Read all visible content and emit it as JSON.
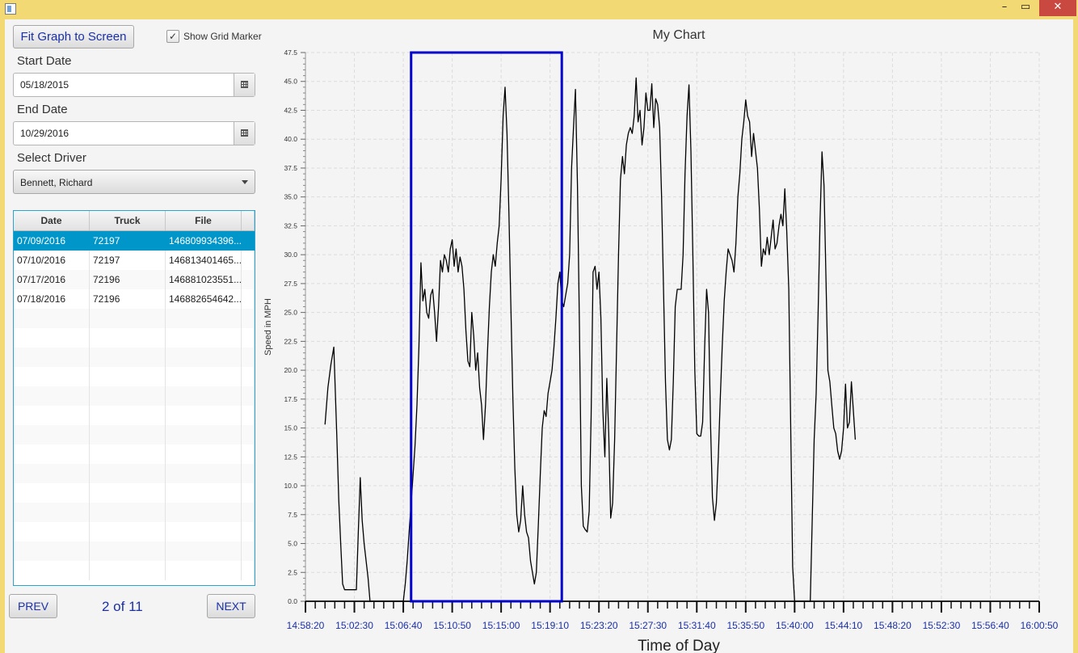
{
  "window": {
    "minimize": "–",
    "maximize": "▭",
    "close": "✕"
  },
  "controls": {
    "fit_button": "Fit Graph to Screen",
    "grid_checkbox": {
      "label": "Show Grid Marker",
      "checked": true,
      "mark": "✓"
    },
    "start_date_label": "Start Date",
    "start_date_value": "05/18/2015",
    "end_date_label": "End Date",
    "end_date_value": "10/29/2016",
    "driver_label": "Select Driver",
    "driver_value": "Bennett, Richard",
    "calendar_icon": "calendar-icon"
  },
  "table": {
    "columns": [
      "Date",
      "Truck",
      "File"
    ],
    "rows": [
      [
        "07/09/2016",
        "72197",
        "146809934396..."
      ],
      [
        "07/10/2016",
        "72197",
        "146813401465..."
      ],
      [
        "07/17/2016",
        "72196",
        "146881023551..."
      ],
      [
        "07/18/2016",
        "72196",
        "146882654642..."
      ]
    ],
    "selected_row": 0,
    "empty_rows": 14
  },
  "pager": {
    "prev": "PREV",
    "page_text": "2 of 11",
    "next": "NEXT"
  },
  "chart_data": {
    "type": "line",
    "title": "My Chart",
    "xlabel": "Time of Day",
    "ylabel": "Speed in MPH",
    "xlim": [
      "14:58:20",
      "16:00:50"
    ],
    "ylim": [
      0,
      47.5
    ],
    "x_ticks": [
      "14:58:20",
      "15:02:30",
      "15:06:40",
      "15:10:50",
      "15:15:00",
      "15:19:10",
      "15:23:20",
      "15:27:30",
      "15:31:40",
      "15:35:50",
      "15:40:00",
      "15:44:10",
      "15:48:20",
      "15:52:30",
      "15:56:40",
      "16:00:50"
    ],
    "y_ticks": [
      "0.0",
      "2.5",
      "5.0",
      "7.5",
      "10.0",
      "12.5",
      "15.0",
      "17.5",
      "20.0",
      "22.5",
      "25.0",
      "27.5",
      "30.0",
      "32.5",
      "35.0",
      "37.5",
      "40.0",
      "42.5",
      "45.0",
      "47.5"
    ],
    "grid": true,
    "selection": {
      "x_start": "15:07:20",
      "x_end": "15:20:10",
      "y_start": 0,
      "y_end": 47.5,
      "color": "#0000cc"
    },
    "series": [
      {
        "color": "#000000",
        "points": [
          [
            "15:00:00",
            15.3
          ],
          [
            "15:00:15",
            18.5
          ],
          [
            "15:00:30",
            20.5
          ],
          [
            "15:00:45",
            22.0
          ],
          [
            "15:01:00",
            14.5
          ],
          [
            "15:01:10",
            8.8
          ],
          [
            "15:01:20",
            5.0
          ],
          [
            "15:01:30",
            1.5
          ],
          [
            "15:01:40",
            1.0
          ],
          [
            "15:02:00",
            1.0
          ],
          [
            "15:02:20",
            1.0
          ],
          [
            "15:02:40",
            1.0
          ],
          [
            "15:02:50",
            6.0
          ],
          [
            "15:03:00",
            10.7
          ],
          [
            "15:03:10",
            7.0
          ],
          [
            "15:03:20",
            5.0
          ],
          [
            "15:03:40",
            2.0
          ],
          [
            "15:03:50",
            0.0
          ],
          [
            "15:04:20",
            0.0
          ],
          [
            "15:05:00",
            0.0
          ],
          [
            "15:05:40",
            0.0
          ],
          [
            "15:06:20",
            0.0
          ],
          [
            "15:06:40",
            0.0
          ],
          [
            "15:06:50",
            1.5
          ],
          [
            "15:07:00",
            3.5
          ],
          [
            "15:07:10",
            6.0
          ],
          [
            "15:07:20",
            8.5
          ],
          [
            "15:07:30",
            11.0
          ],
          [
            "15:07:40",
            13.5
          ],
          [
            "15:07:50",
            17.0
          ],
          [
            "15:08:00",
            22.0
          ],
          [
            "15:08:10",
            29.3
          ],
          [
            "15:08:20",
            26.0
          ],
          [
            "15:08:30",
            27.0
          ],
          [
            "15:08:40",
            25.0
          ],
          [
            "15:08:50",
            24.5
          ],
          [
            "15:09:00",
            26.5
          ],
          [
            "15:09:10",
            27.0
          ],
          [
            "15:09:20",
            25.0
          ],
          [
            "15:09:30",
            22.5
          ],
          [
            "15:09:40",
            25.5
          ],
          [
            "15:09:50",
            29.5
          ],
          [
            "15:10:00",
            28.5
          ],
          [
            "15:10:10",
            30.0
          ],
          [
            "15:10:20",
            29.5
          ],
          [
            "15:10:30",
            28.5
          ],
          [
            "15:10:40",
            30.5
          ],
          [
            "15:10:50",
            31.3
          ],
          [
            "15:11:00",
            29.0
          ],
          [
            "15:11:10",
            30.5
          ],
          [
            "15:11:20",
            28.5
          ],
          [
            "15:11:30",
            29.8
          ],
          [
            "15:11:40",
            29.0
          ],
          [
            "15:11:50",
            27.0
          ],
          [
            "15:12:00",
            23.5
          ],
          [
            "15:12:10",
            20.8
          ],
          [
            "15:12:20",
            20.3
          ],
          [
            "15:12:30",
            25.0
          ],
          [
            "15:12:40",
            23.0
          ],
          [
            "15:12:50",
            20.0
          ],
          [
            "15:13:00",
            21.5
          ],
          [
            "15:13:10",
            18.5
          ],
          [
            "15:13:20",
            17.0
          ],
          [
            "15:13:30",
            14.0
          ],
          [
            "15:13:40",
            17.0
          ],
          [
            "15:13:50",
            21.5
          ],
          [
            "15:14:00",
            25.5
          ],
          [
            "15:14:10",
            28.5
          ],
          [
            "15:14:20",
            30.0
          ],
          [
            "15:14:30",
            29.0
          ],
          [
            "15:14:40",
            31.0
          ],
          [
            "15:14:50",
            32.5
          ],
          [
            "15:15:00",
            36.5
          ],
          [
            "15:15:10",
            42.0
          ],
          [
            "15:15:20",
            44.5
          ],
          [
            "15:15:30",
            40.5
          ],
          [
            "15:15:40",
            33.5
          ],
          [
            "15:15:50",
            25.5
          ],
          [
            "15:16:00",
            17.5
          ],
          [
            "15:16:10",
            11.5
          ],
          [
            "15:16:20",
            7.5
          ],
          [
            "15:16:30",
            6.0
          ],
          [
            "15:16:40",
            7.0
          ],
          [
            "15:16:50",
            10.0
          ],
          [
            "15:17:00",
            7.5
          ],
          [
            "15:17:10",
            6.0
          ],
          [
            "15:17:20",
            5.5
          ],
          [
            "15:17:30",
            3.5
          ],
          [
            "15:17:40",
            2.5
          ],
          [
            "15:17:50",
            1.5
          ],
          [
            "15:18:00",
            2.5
          ],
          [
            "15:18:10",
            6.5
          ],
          [
            "15:18:20",
            11.0
          ],
          [
            "15:18:30",
            15.0
          ],
          [
            "15:18:40",
            16.5
          ],
          [
            "15:18:50",
            16.0
          ],
          [
            "15:19:00",
            18.0
          ],
          [
            "15:19:10",
            19.0
          ],
          [
            "15:19:20",
            20.0
          ],
          [
            "15:19:30",
            22.0
          ],
          [
            "15:19:40",
            24.5
          ],
          [
            "15:19:50",
            27.5
          ],
          [
            "15:20:00",
            28.5
          ],
          [
            "15:20:10",
            26.0
          ],
          [
            "15:20:20",
            25.5
          ],
          [
            "15:20:30",
            26.5
          ],
          [
            "15:20:40",
            27.5
          ],
          [
            "15:20:50",
            30.0
          ],
          [
            "15:21:00",
            37.5
          ],
          [
            "15:21:10",
            41.0
          ],
          [
            "15:21:20",
            44.3
          ],
          [
            "15:21:30",
            36.0
          ],
          [
            "15:21:40",
            24.0
          ],
          [
            "15:21:50",
            10.0
          ],
          [
            "15:22:00",
            6.5
          ],
          [
            "15:22:10",
            6.2
          ],
          [
            "15:22:20",
            6.0
          ],
          [
            "15:22:30",
            7.8
          ],
          [
            "15:22:40",
            16.0
          ],
          [
            "15:22:50",
            28.5
          ],
          [
            "15:23:00",
            29.0
          ],
          [
            "15:23:10",
            27.0
          ],
          [
            "15:23:20",
            28.5
          ],
          [
            "15:23:30",
            24.5
          ],
          [
            "15:23:40",
            16.5
          ],
          [
            "15:23:50",
            12.5
          ],
          [
            "15:24:00",
            19.3
          ],
          [
            "15:24:10",
            14.5
          ],
          [
            "15:24:20",
            7.2
          ],
          [
            "15:24:30",
            8.5
          ],
          [
            "15:24:40",
            14.0
          ],
          [
            "15:24:50",
            22.0
          ],
          [
            "15:25:00",
            30.0
          ],
          [
            "15:25:10",
            36.5
          ],
          [
            "15:25:20",
            38.5
          ],
          [
            "15:25:30",
            37.0
          ],
          [
            "15:25:40",
            39.5
          ],
          [
            "15:25:50",
            40.5
          ],
          [
            "15:26:00",
            41.0
          ],
          [
            "15:26:10",
            40.5
          ],
          [
            "15:26:20",
            42.0
          ],
          [
            "15:26:30",
            45.3
          ],
          [
            "15:26:40",
            41.5
          ],
          [
            "15:26:50",
            42.5
          ],
          [
            "15:27:00",
            39.5
          ],
          [
            "15:27:10",
            41.0
          ],
          [
            "15:27:20",
            44.0
          ],
          [
            "15:27:30",
            42.5
          ],
          [
            "15:27:40",
            42.5
          ],
          [
            "15:27:50",
            44.8
          ],
          [
            "15:28:00",
            41.0
          ],
          [
            "15:28:10",
            43.5
          ],
          [
            "15:28:20",
            43.0
          ],
          [
            "15:28:30",
            41.0
          ],
          [
            "15:28:40",
            35.0
          ],
          [
            "15:28:50",
            27.0
          ],
          [
            "15:29:00",
            19.0
          ],
          [
            "15:29:10",
            14.0
          ],
          [
            "15:29:20",
            13.1
          ],
          [
            "15:29:30",
            14.0
          ],
          [
            "15:29:40",
            19.0
          ],
          [
            "15:29:50",
            25.5
          ],
          [
            "15:30:00",
            27.0
          ],
          [
            "15:30:10",
            27.0
          ],
          [
            "15:30:20",
            27.0
          ],
          [
            "15:30:30",
            30.0
          ],
          [
            "15:30:40",
            37.0
          ],
          [
            "15:30:50",
            42.0
          ],
          [
            "15:31:00",
            44.7
          ],
          [
            "15:31:10",
            39.0
          ],
          [
            "15:31:20",
            30.0
          ],
          [
            "15:31:30",
            20.0
          ],
          [
            "15:31:40",
            14.5
          ],
          [
            "15:31:50",
            14.3
          ],
          [
            "15:32:00",
            14.3
          ],
          [
            "15:32:10",
            15.5
          ],
          [
            "15:32:20",
            22.0
          ],
          [
            "15:32:30",
            27.0
          ],
          [
            "15:32:40",
            25.0
          ],
          [
            "15:32:50",
            15.5
          ],
          [
            "15:33:00",
            9.0
          ],
          [
            "15:33:10",
            7.0
          ],
          [
            "15:33:20",
            8.5
          ],
          [
            "15:33:30",
            12.5
          ],
          [
            "15:33:40",
            17.5
          ],
          [
            "15:33:50",
            22.0
          ],
          [
            "15:34:00",
            26.0
          ],
          [
            "15:34:10",
            28.5
          ],
          [
            "15:34:20",
            30.5
          ],
          [
            "15:34:30",
            30.0
          ],
          [
            "15:34:40",
            29.5
          ],
          [
            "15:34:50",
            28.5
          ],
          [
            "15:35:00",
            31.0
          ],
          [
            "15:35:10",
            35.0
          ],
          [
            "15:35:20",
            37.0
          ],
          [
            "15:35:30",
            40.0
          ],
          [
            "15:35:40",
            41.5
          ],
          [
            "15:35:50",
            43.4
          ],
          [
            "15:36:00",
            42.0
          ],
          [
            "15:36:10",
            41.5
          ],
          [
            "15:36:20",
            38.5
          ],
          [
            "15:36:30",
            40.5
          ],
          [
            "15:36:40",
            39.0
          ],
          [
            "15:36:50",
            37.5
          ],
          [
            "15:37:00",
            34.0
          ],
          [
            "15:37:10",
            29.0
          ],
          [
            "15:37:20",
            30.5
          ],
          [
            "15:37:30",
            30.0
          ],
          [
            "15:37:40",
            31.5
          ],
          [
            "15:37:50",
            30.0
          ],
          [
            "15:38:00",
            31.5
          ],
          [
            "15:38:10",
            33.0
          ],
          [
            "15:38:20",
            30.5
          ],
          [
            "15:38:30",
            31.0
          ],
          [
            "15:38:40",
            32.5
          ],
          [
            "15:38:50",
            33.5
          ],
          [
            "15:39:00",
            32.5
          ],
          [
            "15:39:10",
            35.7
          ],
          [
            "15:39:20",
            32.0
          ],
          [
            "15:39:30",
            27.0
          ],
          [
            "15:39:40",
            15.0
          ],
          [
            "15:39:50",
            3.0
          ],
          [
            "15:40:00",
            0.0
          ],
          [
            "15:40:20",
            0.0
          ],
          [
            "15:40:40",
            0.0
          ],
          [
            "15:41:00",
            0.0
          ],
          [
            "15:41:20",
            0.0
          ],
          [
            "15:41:40",
            14.0
          ],
          [
            "15:41:50",
            18.0
          ],
          [
            "15:42:00",
            25.0
          ],
          [
            "15:42:10",
            33.0
          ],
          [
            "15:42:20",
            38.9
          ],
          [
            "15:42:30",
            36.0
          ],
          [
            "15:42:40",
            28.0
          ],
          [
            "15:42:50",
            20.0
          ],
          [
            "15:43:00",
            19.0
          ],
          [
            "15:43:10",
            17.0
          ],
          [
            "15:43:20",
            15.0
          ],
          [
            "15:43:30",
            14.5
          ],
          [
            "15:43:40",
            13.0
          ],
          [
            "15:43:50",
            12.3
          ],
          [
            "15:44:00",
            13.0
          ],
          [
            "15:44:10",
            15.0
          ],
          [
            "15:44:20",
            18.8
          ],
          [
            "15:44:30",
            15.0
          ],
          [
            "15:44:40",
            15.5
          ],
          [
            "15:44:50",
            19.0
          ],
          [
            "15:45:00",
            16.5
          ],
          [
            "15:45:10",
            14.0
          ]
        ]
      }
    ]
  }
}
